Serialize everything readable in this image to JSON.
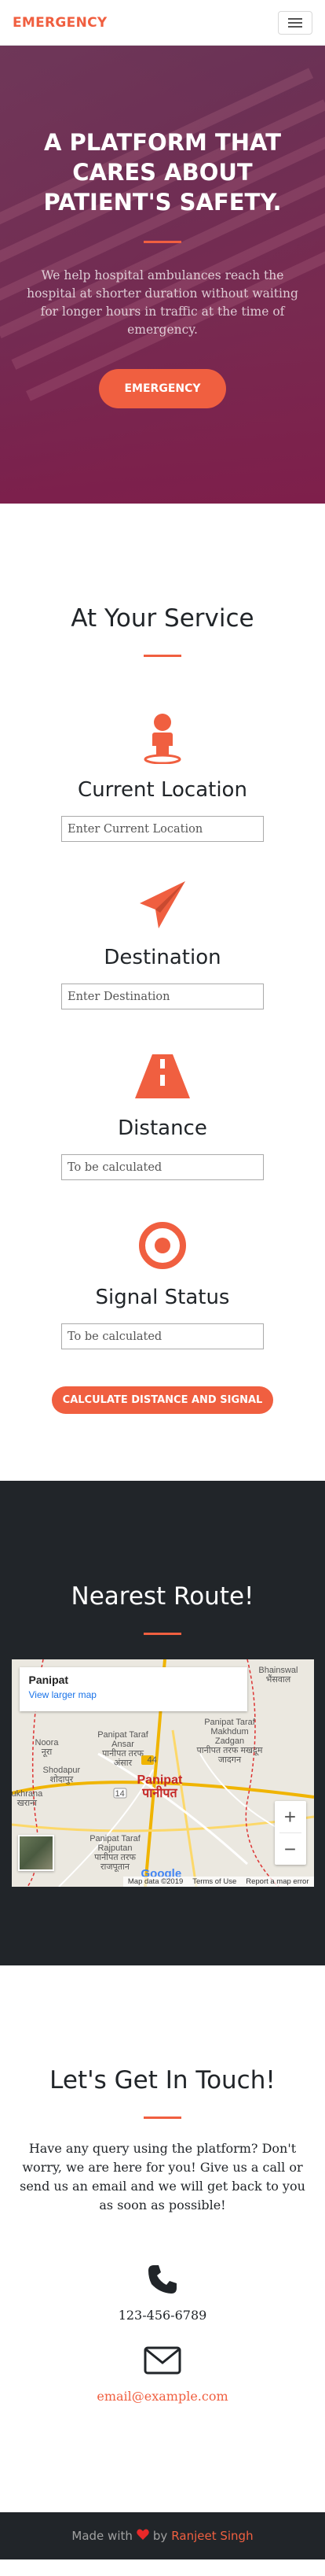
{
  "navbar": {
    "brand": "EMERGENCY",
    "menu_icon": "hamburger-icon"
  },
  "hero": {
    "title": "A PLATFORM THAT CARES ABOUT PATIENT'S SAFETY.",
    "text": "We help hospital ambulances reach the hospital at shorter duration without waiting for longer hours in traffic at the time of emergency.",
    "button": "EMERGENCY"
  },
  "services": {
    "title": "At Your Service",
    "items": [
      {
        "icon": "person-pin-icon",
        "heading": "Current Location",
        "placeholder": "Enter Current Location"
      },
      {
        "icon": "paper-plane-icon",
        "heading": "Destination",
        "placeholder": "Enter Destination"
      },
      {
        "icon": "road-icon",
        "heading": "Distance",
        "placeholder": "To be calculated"
      },
      {
        "icon": "target-icon",
        "heading": "Signal Status",
        "placeholder": "To be calculated"
      }
    ],
    "button": "CALCULATE DISTANCE AND SIGNAL"
  },
  "route": {
    "title": "Nearest Route!",
    "map": {
      "place": "Panipat",
      "larger_link": "View larger map",
      "labels": {
        "bhainswal": "Bhainswal",
        "bhainswal_hi": "भैंसवाल",
        "noora": "Noora",
        "noora_hi": "नूरा",
        "taraf_ansar": "Panipat Taraf Ansar",
        "taraf_ansar_hi": "पानीपत तरफ अंसार",
        "taraf_makhdum": "Panipat Taraf Makhdum Zadgan",
        "taraf_makhdum_hi": "पानीपत तरफ मखदूम जादगन",
        "shodapur": "Shodapur",
        "shodapur_hi": "शोदापुर",
        "ukhrana": "ukhrana",
        "ukhrana_hi": "खराना",
        "city": "Panipat",
        "city_hi": "पानीपत",
        "taraf_rajputan": "Panipat Taraf Rajputan",
        "taraf_rajputan_hi": "पानीपत तरफ राजपूतान",
        "road_44": "44",
        "road_14": "14"
      },
      "zoom_in": "+",
      "zoom_out": "−",
      "google": "Google",
      "map_data": "Map data ©2019",
      "terms": "Terms of Use",
      "report": "Report a map error"
    }
  },
  "contact": {
    "title": "Let's Get In Touch!",
    "text": "Have any query using the platform? Don't worry, we are here for you! Give us a call or send us an email and we will get back to you as soon as possible!",
    "phone": "123-456-6789",
    "email": "email@example.com"
  },
  "footer": {
    "made_with": "Made with",
    "by": "by",
    "author": "Ranjeet Singh"
  },
  "colors": {
    "accent": "#f05f40",
    "dark": "#212529"
  }
}
